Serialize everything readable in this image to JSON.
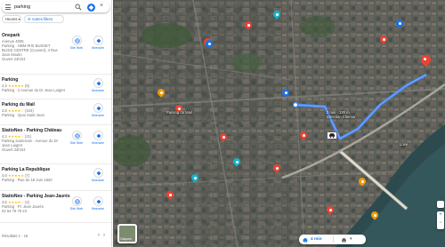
{
  "search": {
    "query": "parking"
  },
  "filters": [
    {
      "label": "Heures"
    },
    {
      "label": "Autres filtres"
    }
  ],
  "results": [
    {
      "name": "Onepark",
      "lines": [
        "Avenue 4005",
        "Parking · HBM IRIS BUSSET",
        "BLOIS CENTRE (Couvert), 4 Rue",
        "Jean Moulin",
        "Ouvert 24h/24"
      ],
      "rating": null,
      "reviews": null,
      "actions": [
        {
          "label": "Site Web"
        },
        {
          "label": "Itinéraire"
        }
      ]
    },
    {
      "name": "Parking",
      "rating": "4,3",
      "stars": "★★★★★",
      "reviews": "(5)",
      "lines": [
        "Parking · 2 Avenue du Dr Jean Laigret"
      ],
      "actions": [
        {
          "label": "Itinéraire"
        }
      ]
    },
    {
      "name": "Parking du Mail",
      "rating": "3,8",
      "stars": "★★★★☆",
      "reviews": "(104)",
      "lines": [
        "Parking · Quai Saint-Jean"
      ],
      "actions": [
        {
          "label": "Itinéraire"
        }
      ]
    },
    {
      "name": "StatioNeo - Parking Château",
      "rating": "4,2",
      "stars": "★★★★☆",
      "reviews": "(21)",
      "lines": [
        "Parking souterrain · Avenue du Dr",
        "Jean Laigret",
        "Ouvert 24h/24"
      ],
      "actions": [
        {
          "label": "Site Web"
        },
        {
          "label": "Itinéraire"
        }
      ]
    },
    {
      "name": "Parking La Republique",
      "rating": "4,6",
      "stars": "★★★★★",
      "reviews": "(7)",
      "lines": [
        "Parking · Rue du 18 Juin 1940"
      ],
      "actions": [
        {
          "label": "Itinéraire"
        }
      ]
    },
    {
      "name": "StatioNeo - Parking Jean-Jaurès",
      "rating": "3,6",
      "stars": "★★★★☆",
      "reviews": "(2)",
      "lines": [
        "Parking · Pl. Jean Jaurès",
        "02 54 78 79 23"
      ],
      "actions": [
        {
          "label": "Site Web"
        },
        {
          "label": "Itinéraire"
        }
      ]
    }
  ],
  "paging": {
    "text": "Résultats 1 - 18"
  },
  "map": {
    "route_label": [
      "2 min",
      "120 m"
    ],
    "route_label_sub": "Direction Chemin",
    "labels": [
      "Parking du Mail",
      "Loire"
    ],
    "layers_label": "Calques",
    "route_time": "4 min"
  },
  "colors": {
    "route": "#4285f4",
    "accent": "#1a73e8",
    "pin": "#ea4335"
  }
}
